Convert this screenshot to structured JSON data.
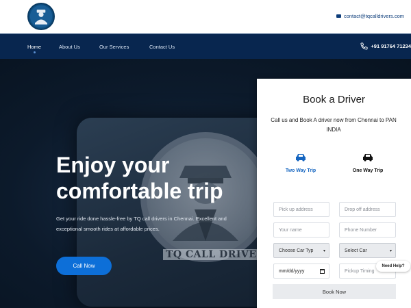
{
  "header": {
    "email": "contact@tqcalldrivers.com"
  },
  "nav": {
    "items": [
      "Home",
      "About Us",
      "Our Services",
      "Contact Us"
    ],
    "phone": "+91 91764 71234"
  },
  "hero": {
    "title_line1": "Enjoy your",
    "title_line2": "comfortable trip",
    "subtitle": "Get your ride done hassle-free by TQ call drivers in Chennai. Excellent and exceptional smooth rides at affordable prices.",
    "button": "Call Now",
    "badge_text": "TQ CALL DRIVER"
  },
  "booking": {
    "title": "Book a Driver",
    "description": "Call us and Book A driver now from Chennai to PAN INDIA",
    "trip_two_way": "Two Way Trip",
    "trip_one_way": "One Way Trip",
    "pickup_placeholder": "Pick up address",
    "drop_placeholder": "Drop off address",
    "name_placeholder": "Your name",
    "phone_placeholder": "Phone Number",
    "car_type": "Choose Car Typ",
    "select_car": "Select Car",
    "date_value": "mm/dd/yyyy",
    "timing_placeholder": "Pickup Timing",
    "submit": "Book Now"
  },
  "help": "Need Help?",
  "colors": {
    "nav_bg": "#08264f",
    "accent": "#0d6fd8",
    "trip_active": "#1565c0"
  }
}
